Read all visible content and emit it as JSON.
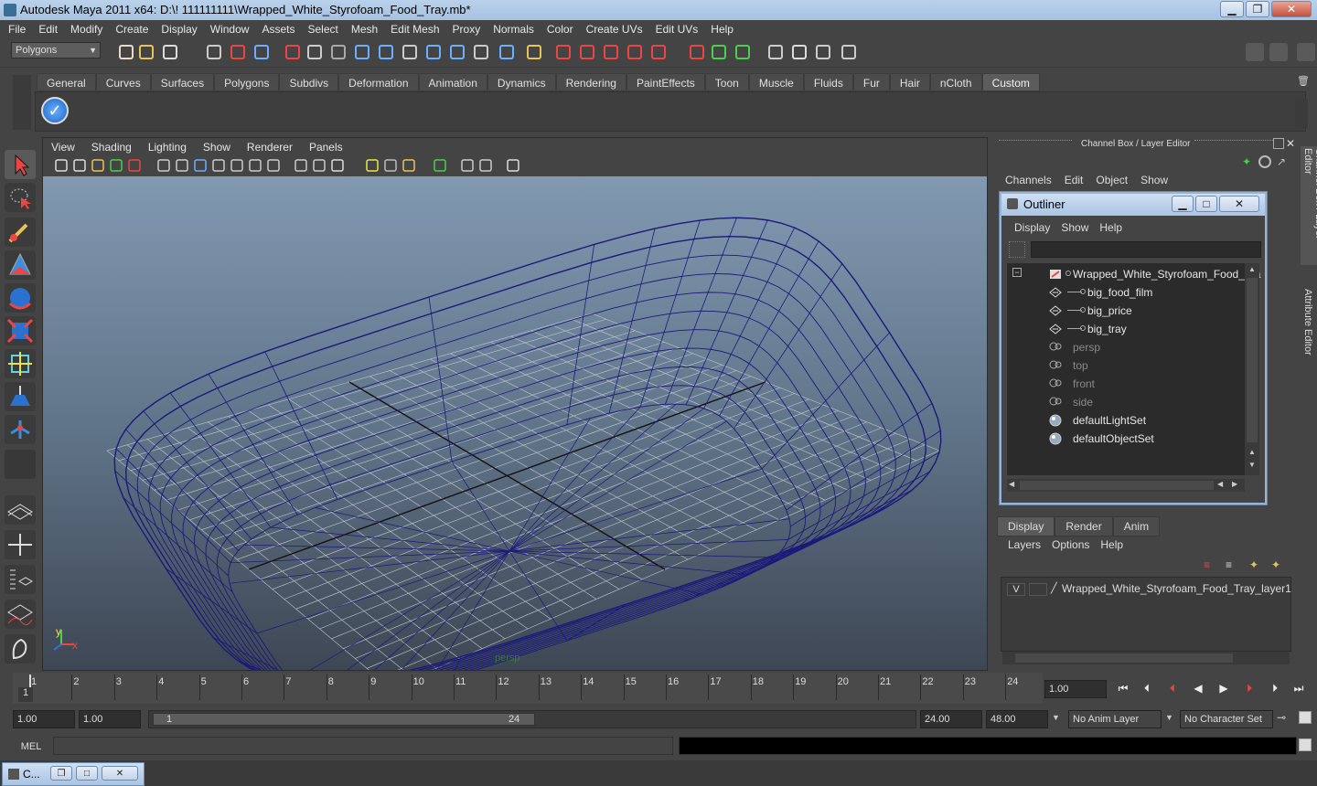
{
  "window": {
    "title": "Autodesk Maya 2011 x64: D:\\! 111111111\\Wrapped_White_Styrofoam_Food_Tray.mb*",
    "minimize": "▁",
    "maximize": "❐",
    "close": "✕"
  },
  "menubar": [
    "File",
    "Edit",
    "Modify",
    "Create",
    "Display",
    "Window",
    "Assets",
    "Select",
    "Mesh",
    "Edit Mesh",
    "Proxy",
    "Normals",
    "Color",
    "Create UVs",
    "Edit UVs",
    "Help"
  ],
  "statusline": {
    "mode": "Polygons"
  },
  "shelf": {
    "tabs": [
      "General",
      "Curves",
      "Surfaces",
      "Polygons",
      "Subdivs",
      "Deformation",
      "Animation",
      "Dynamics",
      "Rendering",
      "PaintEffects",
      "Toon",
      "Muscle",
      "Fluids",
      "Fur",
      "Hair",
      "nCloth",
      "Custom"
    ],
    "active_tab": "Custom"
  },
  "viewport": {
    "menu": [
      "View",
      "Shading",
      "Lighting",
      "Show",
      "Renderer",
      "Panels"
    ],
    "camera_label": "persp",
    "axis_x": "x",
    "axis_y": "y",
    "colors": {
      "wire": "#1a1a7a",
      "grid": "#c0c8d2",
      "bg_top": "#8199b1",
      "bg_bottom": "#3e4754"
    }
  },
  "channelbox": {
    "title": "Channel Box / Layer Editor",
    "menu": [
      "Channels",
      "Edit",
      "Object",
      "Show"
    ],
    "side_tabs": [
      "Channel Box / Layer Editor",
      "Attribute Editor"
    ]
  },
  "outliner": {
    "title": "Outliner",
    "menu": [
      "Display",
      "Show",
      "Help"
    ],
    "items": [
      {
        "label": "Wrapped_White_Styrofoam_Food_Tra",
        "dim": false,
        "indent": 0
      },
      {
        "label": "big_food_film",
        "dim": false,
        "indent": 1
      },
      {
        "label": "big_price",
        "dim": false,
        "indent": 1
      },
      {
        "label": "big_tray",
        "dim": false,
        "indent": 1
      },
      {
        "label": "persp",
        "dim": true,
        "indent": 0
      },
      {
        "label": "top",
        "dim": true,
        "indent": 0
      },
      {
        "label": "front",
        "dim": true,
        "indent": 0
      },
      {
        "label": "side",
        "dim": true,
        "indent": 0
      },
      {
        "label": "defaultLightSet",
        "dim": false,
        "indent": 0
      },
      {
        "label": "defaultObjectSet",
        "dim": false,
        "indent": 0
      }
    ]
  },
  "layer_editor": {
    "tabs": [
      "Display",
      "Render",
      "Anim"
    ],
    "active_tab": "Display",
    "menu": [
      "Layers",
      "Options",
      "Help"
    ],
    "layer": {
      "visible": "V",
      "name": "Wrapped_White_Styrofoam_Food_Tray_layer1"
    }
  },
  "timeline": {
    "ticks": [
      "1",
      "2",
      "3",
      "4",
      "5",
      "6",
      "7",
      "8",
      "9",
      "10",
      "11",
      "12",
      "13",
      "14",
      "15",
      "16",
      "17",
      "18",
      "19",
      "20",
      "21",
      "22",
      "23",
      "24"
    ],
    "current_frame_marker": "1",
    "current_time": "1.00"
  },
  "range": {
    "start": "1.00",
    "start2": "1.00",
    "slider_start": "1",
    "slider_end": "24",
    "end": "24.00",
    "end2": "48.00",
    "anim_layer": "No Anim Layer",
    "char_set": "No Character Set"
  },
  "cmdline": {
    "label": "MEL"
  },
  "taskbar": {
    "item": "C..."
  }
}
